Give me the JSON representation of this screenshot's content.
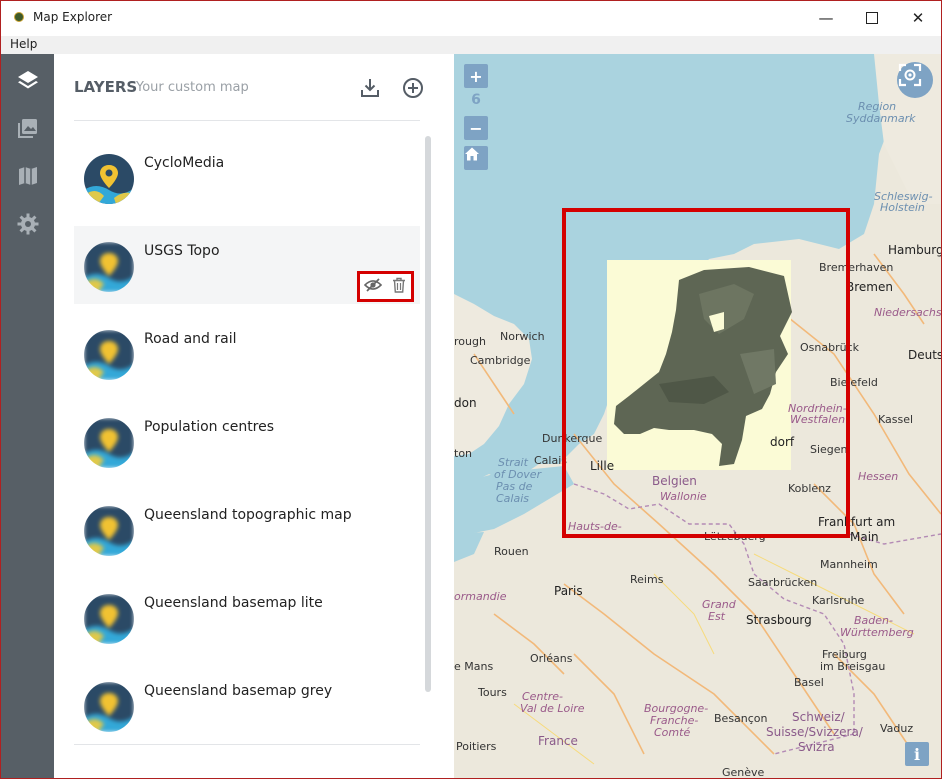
{
  "window": {
    "title": "Map Explorer",
    "minimize": "—",
    "close": "✕"
  },
  "menu": {
    "help": "Help"
  },
  "rail": {
    "items": [
      {
        "name": "layers"
      },
      {
        "name": "gallery"
      },
      {
        "name": "map"
      },
      {
        "name": "settings"
      }
    ]
  },
  "panel": {
    "title": "LAYERS",
    "subtitle": "Your custom map",
    "layers": [
      {
        "name": "CycloMedia"
      },
      {
        "name": "USGS Topo"
      },
      {
        "name": "Road and rail"
      },
      {
        "name": "Population centres"
      },
      {
        "name": "Queensland topographic map"
      },
      {
        "name": "Queensland basemap lite"
      },
      {
        "name": "Queensland basemap grey"
      }
    ]
  },
  "map": {
    "zoom_in": "+",
    "zoom_level": "6",
    "zoom_out": "−",
    "info": "i",
    "labels": {
      "region": "Region",
      "syddanmark": "Syddanmark",
      "schleswig": "Schleswig-",
      "holstein": "Holstein",
      "hamburg": "Hamburg",
      "bremerhaven": "Bremerhaven",
      "bremen": "Bremen",
      "niedersachsen": "Niedersachsen",
      "osnabruck": "Osnabrück",
      "deuts": "Deuts",
      "bielefeld": "Bielefeld",
      "nordrhein": "Nordrhein-",
      "westfalen": "Westfalen",
      "kassel": "Kassel",
      "rough": "rough",
      "norwich": "Norwich",
      "cambridge": "Cambridge",
      "don": "don",
      "ton": "ton",
      "dunkerque": "Dunkerque",
      "strait": "Strait",
      "of_dover": "of Dover",
      "pas_de": "Pas de",
      "calais_strait": "Calais",
      "calais": "Calais",
      "lille": "Lille",
      "belgien": "Belgien",
      "wallonie": "Wallonie",
      "dorf": "dorf",
      "siegen": "Siegen",
      "hessen": "Hessen",
      "koblenz": "Koblenz",
      "frankfurt": "Frankfurt am",
      "main": "Main",
      "hauts": "Hauts-de-",
      "luxembourg": "Lëtzebuerg",
      "rouen": "Rouen",
      "reims": "Reims",
      "saarbrucken": "Saarbrücken",
      "mannheim": "Mannheim",
      "karlsruhe": "Karlsruhe",
      "paris": "Paris",
      "normandie": "ormandie",
      "grand": "Grand",
      "est": "Est",
      "strasbourg": "Strasbourg",
      "baden": "Baden-",
      "wurttemberg": "Württemberg",
      "le_mans": "e Mans",
      "orleans": "Orléans",
      "freiburg": "Freiburg",
      "im_breisgau": "im Breisgau",
      "tours": "Tours",
      "centre": "Centre-",
      "val_de_loire": "Val de Loire",
      "bourgogne": "Bourgogne-",
      "franche": "Franche-",
      "comte": "Comté",
      "basel": "Basel",
      "besancon": "Besançon",
      "schweiz": "Schweiz/",
      "suisse": "Suisse/Svizzera/",
      "svizra": "Svizra",
      "vaduz": "Vaduz",
      "france": "France",
      "poitiers": "Poitiers",
      "geneve": "Genève"
    }
  }
}
